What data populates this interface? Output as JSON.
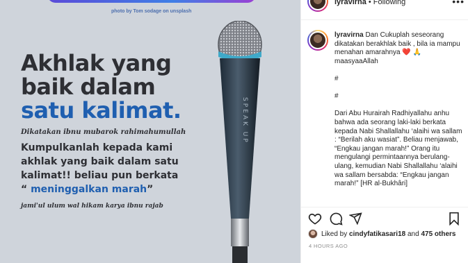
{
  "post_image": {
    "photo_credit": "photo by Tom sodage on unsplash",
    "headline_line1": "Akhlak yang",
    "headline_line2": "baik dalam",
    "headline_accent": "satu kalimat.",
    "quote_source": "Dikatakan ibnu mubarok rahimahumullah",
    "quote_line1": "Kumpulkanlah kepada kami",
    "quote_line2": "akhlak yang baik dalam satu",
    "quote_line3": "kalimat!! beliau pun berkata",
    "quote_open": "“ ",
    "quote_highlight": "meninggalkan marah",
    "quote_close": "”",
    "book_ref": "jami'ul ulum wal hikam karya ibnu rajab",
    "mic_text": "SPEAK UP"
  },
  "header": {
    "username": "lyravirna",
    "separator": "•",
    "follow_status": "Following",
    "more_icon": "more-icon"
  },
  "caption": {
    "username": "lyravirna",
    "text_intro": "Dan Cukuplah seseorang dikatakan berakhlak baik , bila ia mampu menahan amarahnya ",
    "heart": "❤️",
    "pray": "🙏",
    "text_after": "\nmaasyaaAllah",
    "hash1": "#",
    "hash2": "#",
    "body": "Dari Abu Hurairah Radhiyallahu anhu bahwa ada seorang laki-laki berkata kepada Nabi Shallallahu ‘alaihi wa sallam : “Berilah aku wasiat”. Beliau menjawab, “Engkau jangan marah!” Orang itu mengulangi permintaannya berulang-ulang, kemudian Nabi Shallallahu ‘alaihi wa sallam bersabda: “Engkau jangan marah!” [HR al-Bukhâri]"
  },
  "likes": {
    "prefix": "Liked by ",
    "user": "cindyfatikasari18",
    "middle": " and ",
    "others": "475 others"
  },
  "timestamp": "4 HOURS AGO",
  "icons": [
    "heart-icon",
    "comment-icon",
    "share-icon",
    "bookmark-icon"
  ]
}
